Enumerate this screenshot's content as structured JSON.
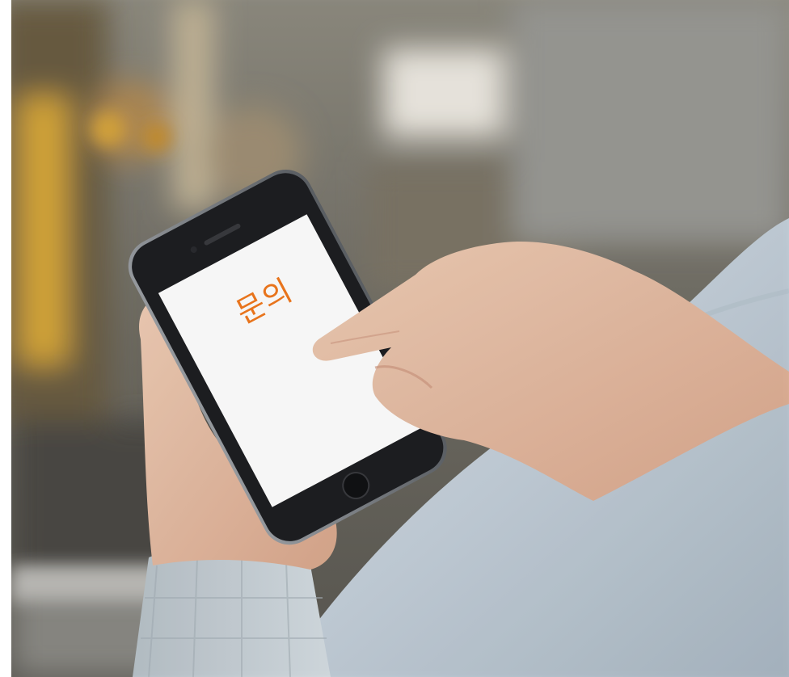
{
  "photo": {
    "subject": "hand-holding-smartphone",
    "screen": {
      "text": "문의",
      "text_color": "#e8741c",
      "background_color": "#ffffff"
    },
    "colors": {
      "background_blur": "#8a877d",
      "sleeve": "#c8d3dc",
      "phone_body": "#1e1f22",
      "skin": "#e9c3ac"
    }
  }
}
